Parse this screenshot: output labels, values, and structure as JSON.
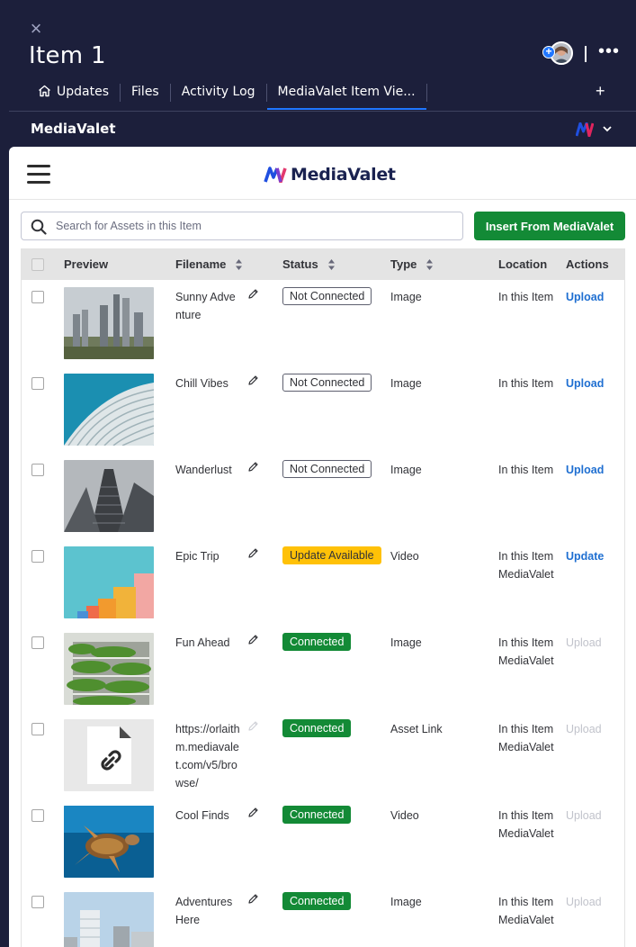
{
  "header": {
    "close_glyph": "×",
    "title": "Item 1",
    "more_glyph": "•••",
    "plus_glyph": "+"
  },
  "tabs": [
    {
      "label": "Updates",
      "icon": "home-icon"
    },
    {
      "label": "Files"
    },
    {
      "label": "Activity Log"
    },
    {
      "label": "MediaValet Item Vie...",
      "active": true
    }
  ],
  "add_tab_glyph": "+",
  "app_bar": {
    "title": "MediaValet",
    "chevron": "⌄"
  },
  "panel": {
    "brand": "MediaValet",
    "search_placeholder": "Search for Assets in this Item",
    "insert_button": "Insert From MediaValet"
  },
  "table": {
    "headers": {
      "preview": "Preview",
      "filename": "Filename",
      "status": "Status",
      "type": "Type",
      "location": "Location",
      "actions": "Actions"
    },
    "rows": [
      {
        "filename": "Sunny Adventure",
        "status": "Not Connected",
        "status_kind": "not",
        "type": "Image",
        "location": [
          "In this Item"
        ],
        "action": "Upload",
        "action_enabled": true,
        "thumb": "city-skyline"
      },
      {
        "filename": "Chill Vibes",
        "status": "Not Connected",
        "status_kind": "not",
        "type": "Image",
        "location": [
          "In this Item"
        ],
        "action": "Upload",
        "action_enabled": true,
        "thumb": "blue-facade"
      },
      {
        "filename": "Wanderlust",
        "status": "Not Connected",
        "status_kind": "not",
        "type": "Image",
        "location": [
          "In this Item"
        ],
        "action": "Upload",
        "action_enabled": true,
        "thumb": "skyscraper"
      },
      {
        "filename": "Epic Trip",
        "status": "Update Available",
        "status_kind": "upd",
        "type": "Video",
        "location": [
          "In this Item",
          "MediaValet"
        ],
        "action": "Update",
        "action_enabled": true,
        "thumb": "colorful-blocks"
      },
      {
        "filename": "Fun Ahead",
        "status": "Connected",
        "status_kind": "con",
        "type": "Image",
        "location": [
          "In this Item",
          "MediaValet"
        ],
        "action": "Upload",
        "action_enabled": false,
        "thumb": "green-building"
      },
      {
        "filename": "https://orlaithm.mediavalet.com/v5/browse/",
        "status": "Connected",
        "status_kind": "con",
        "type": "Asset Link",
        "location": [
          "In this Item",
          "MediaValet"
        ],
        "action": "Upload",
        "action_enabled": false,
        "thumb": "link-file"
      },
      {
        "filename": "Cool Finds",
        "status": "Connected",
        "status_kind": "con",
        "type": "Video",
        "location": [
          "In this Item",
          "MediaValet"
        ],
        "action": "Upload",
        "action_enabled": false,
        "thumb": "sea-turtle"
      },
      {
        "filename": "Adventures Here",
        "status": "Connected",
        "status_kind": "con",
        "type": "Image",
        "location": [
          "In this Item",
          "MediaValet"
        ],
        "action": "Upload",
        "action_enabled": false,
        "thumb": "city-buildings"
      }
    ]
  },
  "colors": {
    "header_bg": "#1c1f3b",
    "accent_blue": "#1f76ff",
    "green": "#138a36",
    "yellow": "#ffc107",
    "link_blue": "#1f6fd1"
  }
}
